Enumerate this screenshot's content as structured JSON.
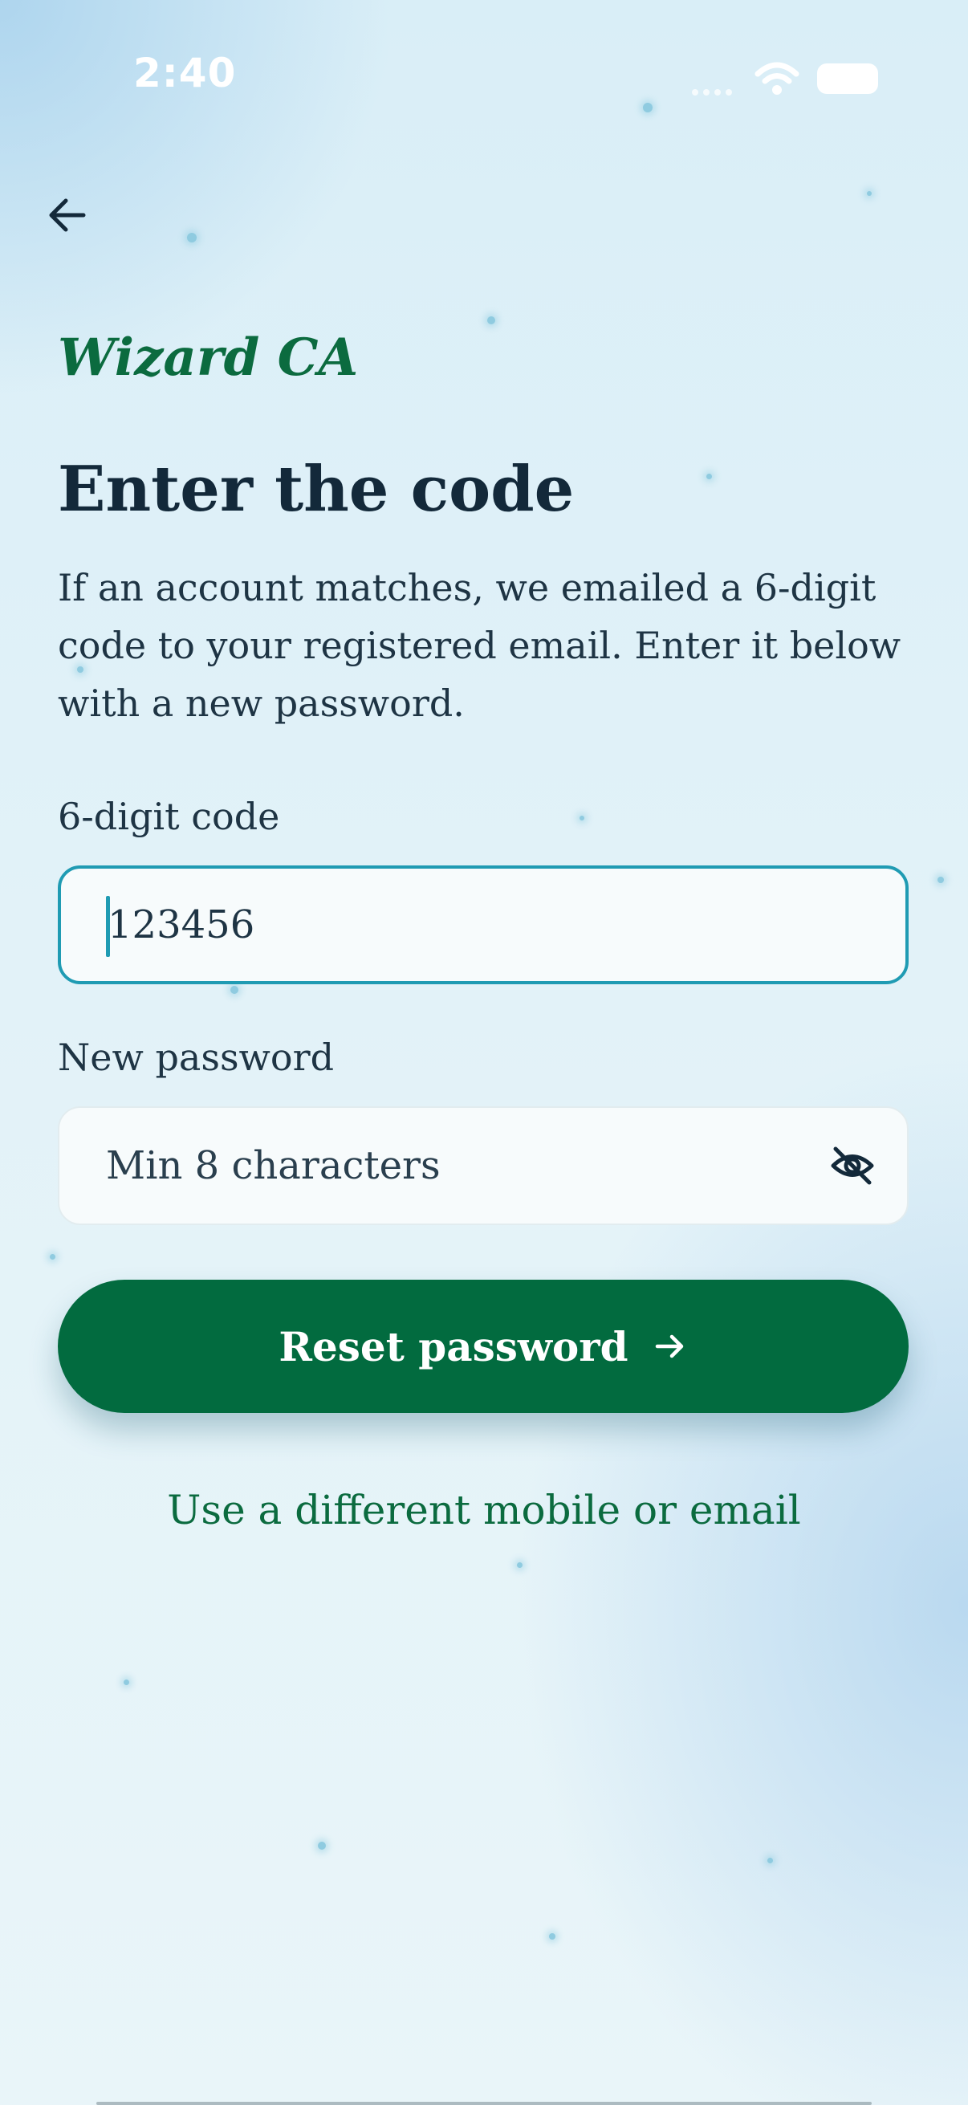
{
  "status_bar": {
    "time": "2:40",
    "icons": [
      "signal-icon",
      "wifi-icon",
      "battery-icon"
    ]
  },
  "header": {
    "back_icon": "arrow-left-icon"
  },
  "brand": {
    "name": "Wizard CA"
  },
  "main": {
    "title": "Enter the code",
    "description": "If an account matches, we emailed a 6-digit code to your registered email. Enter it below with a new password.",
    "code_field": {
      "label": "6-digit code",
      "value": "123456",
      "focused": true
    },
    "password_field": {
      "label": "New password",
      "placeholder": "Min 8 characters",
      "value": "",
      "toggle_icon": "eye-off-icon"
    },
    "submit_button": {
      "label": "Reset password",
      "icon": "arrow-right-icon"
    },
    "alt_link": {
      "label": "Use a different mobile or email"
    }
  },
  "colors": {
    "brand_green": "#0b6b3f",
    "button_green": "#026b3f",
    "focus_teal": "#1f9bb3",
    "text_dark": "#13293a",
    "background": "#e2f2f8"
  }
}
